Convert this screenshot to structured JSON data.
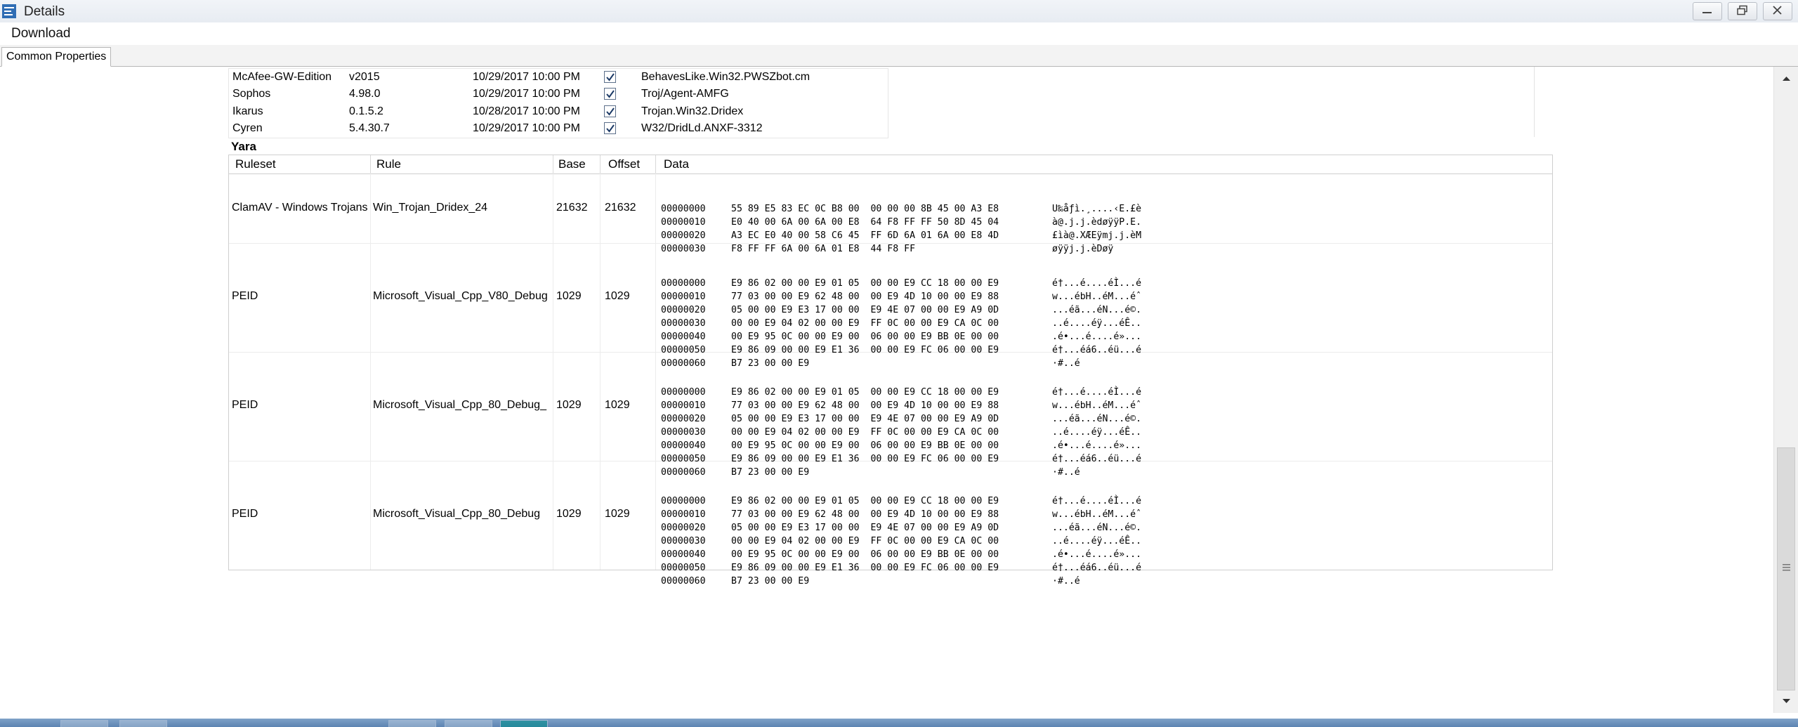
{
  "window": {
    "title": "Details"
  },
  "menu": {
    "download": "Download"
  },
  "tabs": [
    {
      "label": "Common Properties"
    }
  ],
  "av_results": [
    {
      "engine": "McAfee-GW-Edition",
      "version": "v2015",
      "date": "10/29/2017 10:00 PM",
      "detected": true,
      "result": "BehavesLike.Win32.PWSZbot.cm"
    },
    {
      "engine": "Sophos",
      "version": "4.98.0",
      "date": "10/29/2017 10:00 PM",
      "detected": true,
      "result": "Troj/Agent-AMFG"
    },
    {
      "engine": "Ikarus",
      "version": "0.1.5.2",
      "date": "10/28/2017 10:00 PM",
      "detected": true,
      "result": "Trojan.Win32.Dridex"
    },
    {
      "engine": "Cyren",
      "version": "5.4.30.7",
      "date": "10/29/2017 10:00 PM",
      "detected": true,
      "result": "W32/DridLd.ANXF-3312"
    }
  ],
  "yara": {
    "label": "Yara",
    "columns": {
      "ruleset": "Ruleset",
      "rule": "Rule",
      "base": "Base",
      "offset": "Offset",
      "data": "Data"
    },
    "rows": [
      {
        "ruleset": "ClamAV - Windows Trojans",
        "rule": "Win_Trojan_Dridex_24",
        "base": "21632",
        "offset": "21632",
        "data": [
          {
            "addr": "00000000",
            "hex": "55 89 E5 83 EC 0C B8 00  00 00 00 8B 45 00 A3 E8",
            "ascii": "U‰åƒì.¸....‹E.£è"
          },
          {
            "addr": "00000010",
            "hex": "E0 40 00 6A 00 6A 00 E8  64 F8 FF FF 50 8D 45 04",
            "ascii": "à@.j.j.èdøÿÿP.E."
          },
          {
            "addr": "00000020",
            "hex": "A3 EC E0 40 00 58 C6 45  FF 6D 6A 01 6A 00 E8 4D",
            "ascii": "£ìà@.XÆEÿmj.j.èM"
          },
          {
            "addr": "00000030",
            "hex": "F8 FF FF 6A 00 6A 01 E8  44 F8 FF",
            "ascii": "øÿÿj.j.èDøÿ"
          }
        ]
      },
      {
        "ruleset": "PEID",
        "rule": "Microsoft_Visual_Cpp_V80_Debug",
        "base": "1029",
        "offset": "1029",
        "data": [
          {
            "addr": "00000000",
            "hex": "E9 86 02 00 00 E9 01 05  00 00 E9 CC 18 00 00 E9",
            "ascii": "é†...é....éÌ...é"
          },
          {
            "addr": "00000010",
            "hex": "77 03 00 00 E9 62 48 00  00 E9 4D 10 00 00 E9 88",
            "ascii": "w...ébH..éM...éˆ"
          },
          {
            "addr": "00000020",
            "hex": "05 00 00 E9 E3 17 00 00  E9 4E 07 00 00 E9 A9 0D",
            "ascii": "...éã...éN...é©."
          },
          {
            "addr": "00000030",
            "hex": "00 00 E9 04 02 00 00 E9  FF 0C 00 00 E9 CA 0C 00",
            "ascii": "..é....éÿ...éÊ.."
          },
          {
            "addr": "00000040",
            "hex": "00 E9 95 0C 00 00 E9 00  06 00 00 E9 BB 0E 00 00",
            "ascii": ".é•...é....é»..."
          },
          {
            "addr": "00000050",
            "hex": "E9 86 09 00 00 E9 E1 36  00 00 E9 FC 06 00 00 E9",
            "ascii": "é†...éá6..éü...é"
          },
          {
            "addr": "00000060",
            "hex": "B7 23 00 00 E9",
            "ascii": "·#..é"
          }
        ]
      },
      {
        "ruleset": "PEID",
        "rule": "Microsoft_Visual_Cpp_80_Debug_",
        "base": "1029",
        "offset": "1029",
        "data": [
          {
            "addr": "00000000",
            "hex": "E9 86 02 00 00 E9 01 05  00 00 E9 CC 18 00 00 E9",
            "ascii": "é†...é....éÌ...é"
          },
          {
            "addr": "00000010",
            "hex": "77 03 00 00 E9 62 48 00  00 E9 4D 10 00 00 E9 88",
            "ascii": "w...ébH..éM...éˆ"
          },
          {
            "addr": "00000020",
            "hex": "05 00 00 E9 E3 17 00 00  E9 4E 07 00 00 E9 A9 0D",
            "ascii": "...éã...éN...é©."
          },
          {
            "addr": "00000030",
            "hex": "00 00 E9 04 02 00 00 E9  FF 0C 00 00 E9 CA 0C 00",
            "ascii": "..é....éÿ...éÊ.."
          },
          {
            "addr": "00000040",
            "hex": "00 E9 95 0C 00 00 E9 00  06 00 00 E9 BB 0E 00 00",
            "ascii": ".é•...é....é»..."
          },
          {
            "addr": "00000050",
            "hex": "E9 86 09 00 00 E9 E1 36  00 00 E9 FC 06 00 00 E9",
            "ascii": "é†...éá6..éü...é"
          },
          {
            "addr": "00000060",
            "hex": "B7 23 00 00 E9",
            "ascii": "·#..é"
          }
        ]
      },
      {
        "ruleset": "PEID",
        "rule": "Microsoft_Visual_Cpp_80_Debug",
        "base": "1029",
        "offset": "1029",
        "data": [
          {
            "addr": "00000000",
            "hex": "E9 86 02 00 00 E9 01 05  00 00 E9 CC 18 00 00 E9",
            "ascii": "é†...é....éÌ...é"
          },
          {
            "addr": "00000010",
            "hex": "77 03 00 00 E9 62 48 00  00 E9 4D 10 00 00 E9 88",
            "ascii": "w...ébH..éM...éˆ"
          },
          {
            "addr": "00000020",
            "hex": "05 00 00 E9 E3 17 00 00  E9 4E 07 00 00 E9 A9 0D",
            "ascii": "...éã...éN...é©."
          },
          {
            "addr": "00000030",
            "hex": "00 00 E9 04 02 00 00 E9  FF 0C 00 00 E9 CA 0C 00",
            "ascii": "..é....éÿ...éÊ.."
          },
          {
            "addr": "00000040",
            "hex": "00 E9 95 0C 00 00 E9 00  06 00 00 E9 BB 0E 00 00",
            "ascii": ".é•...é....é»..."
          },
          {
            "addr": "00000050",
            "hex": "E9 86 09 00 00 E9 E1 36  00 00 E9 FC 06 00 00 E9",
            "ascii": "é†...éá6..éü...é"
          },
          {
            "addr": "00000060",
            "hex": "B7 23 00 00 E9",
            "ascii": "·#..é"
          }
        ]
      }
    ]
  },
  "icons": {
    "app": "details-app-icon",
    "minimize": "minimize-icon",
    "maximize": "restore-icon",
    "close": "close-icon",
    "checkbox": "checkmark-icon",
    "scroll_up": "chevron-up-icon",
    "scroll_down": "chevron-down-icon"
  },
  "colors": {
    "accent": "#2f6db4",
    "checkbox_border": "#5c6f8a",
    "taskbar": "#5d84b2"
  }
}
